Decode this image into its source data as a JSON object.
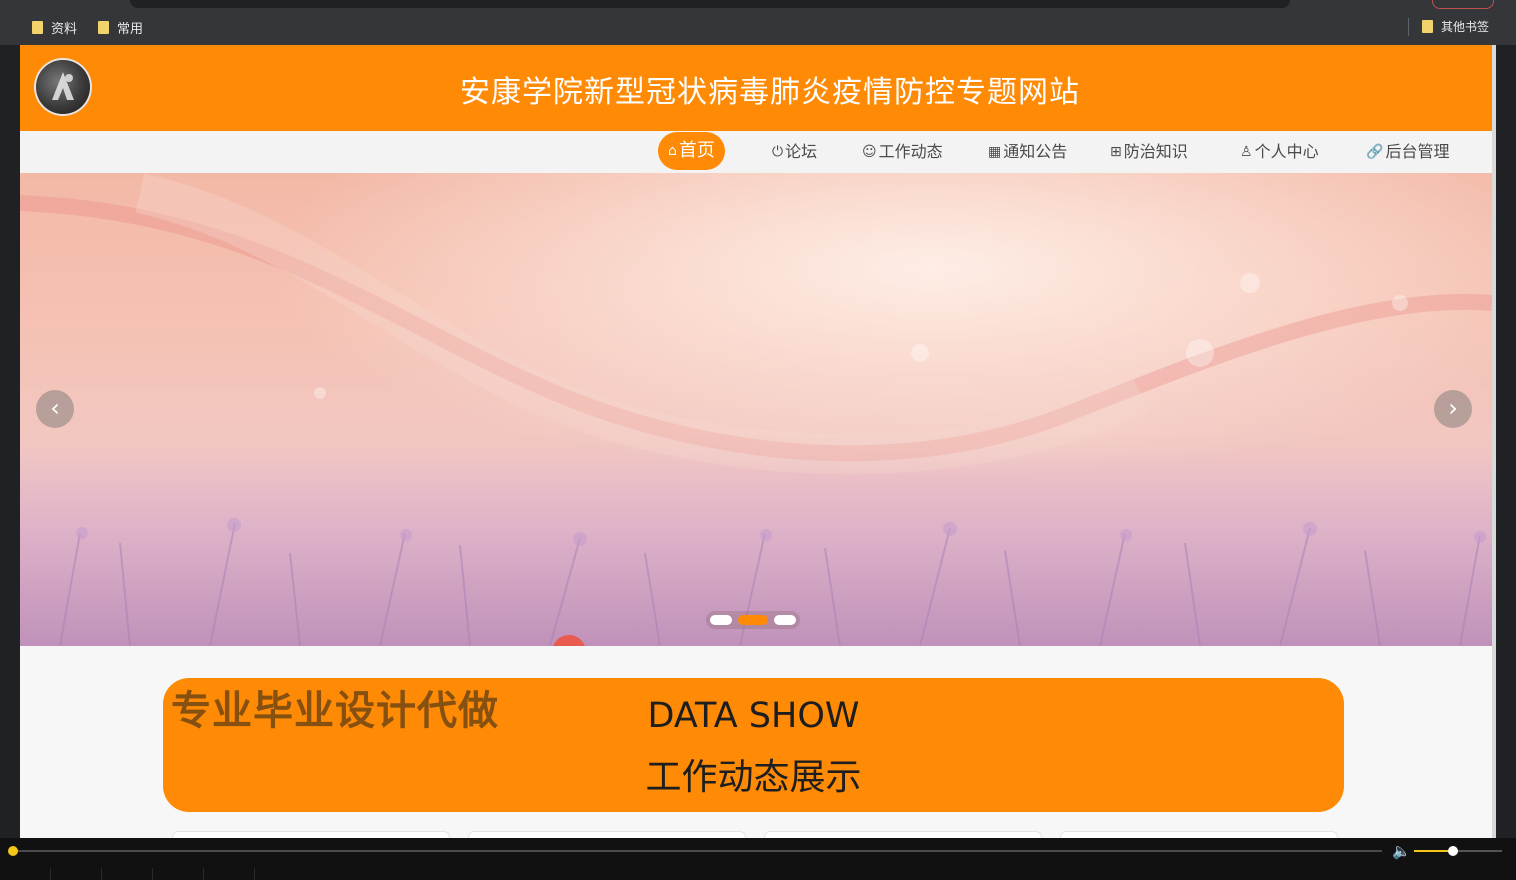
{
  "bookmarks": {
    "left": [
      "资料",
      "常用"
    ],
    "right": "其他书签"
  },
  "site": {
    "title": "安康学院新型冠状病毒肺炎疫情防控专题网站"
  },
  "nav": {
    "items": [
      {
        "icon": "⌂",
        "icon_name": "home-icon",
        "label": "首页",
        "active": true
      },
      {
        "icon": "⏻",
        "icon_name": "power-icon",
        "label": "论坛"
      },
      {
        "icon": "☺",
        "icon_name": "palette-icon",
        "label": "工作动态"
      },
      {
        "icon": "▦",
        "icon_name": "calendar-icon",
        "label": "通知公告"
      },
      {
        "icon": "⊞",
        "icon_name": "grid-icon",
        "label": "防治知识"
      },
      {
        "icon": "♙",
        "icon_name": "user-icon",
        "label": "个人中心"
      },
      {
        "icon": "🔗",
        "icon_name": "link-icon",
        "label": "后台管理"
      }
    ]
  },
  "carousel": {
    "prev_icon": "‹",
    "next_icon": "›",
    "slide_count": 3,
    "active_slide": 2
  },
  "section": {
    "watermark": "专业毕业设计代做",
    "title_en": "DATA SHOW",
    "title_zh": "工作动态展示"
  },
  "player": {
    "progress": 0.0,
    "volume": 0.45
  },
  "colors": {
    "brand": "#ff8a05",
    "nav_bg": "#f3f3f3",
    "browser_bar": "#35363a"
  }
}
